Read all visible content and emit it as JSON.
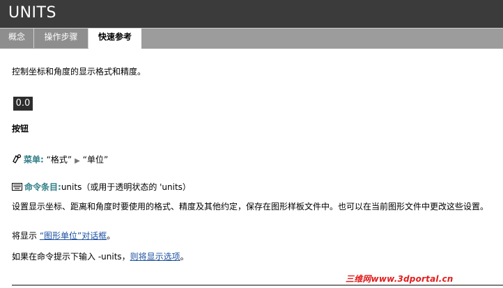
{
  "header": {
    "title": "UNITS"
  },
  "tabs": [
    {
      "label": "概念",
      "active": false
    },
    {
      "label": "操作步骤",
      "active": false
    },
    {
      "label": "快速参考",
      "active": true
    }
  ],
  "body": {
    "intro": "控制坐标和角度的显示格式和精度。",
    "badge": "0.0",
    "buttons_heading": "按钮",
    "menu": {
      "prefix": "菜单:",
      "item1": "“格式”",
      "item2": "“单位”"
    },
    "command": {
      "prefix": "命令条目:",
      "text": "units（或用于透明状态的 'units）"
    },
    "description": "设置显示坐标、距离和角度时要使用的格式、精度及其他约定，保存在图形样板文件中。也可以在当前图形文件中更改这些设置。",
    "dialog_line": {
      "before": "将显示",
      "link": "“图形单位”对话框",
      "after": "。"
    },
    "prompt_line": {
      "before": "如果在命令提示下输入 -units，",
      "link": "则将显示选项",
      "after": "。"
    }
  },
  "watermark": "三维网www.3dportal.cn",
  "colors": {
    "titlebar": "#3b3b3b",
    "tabstrip": "#9c9c9c",
    "accent_teal": "#2f7d86",
    "link": "#1a4fa0",
    "watermark": "#e21c1c"
  }
}
